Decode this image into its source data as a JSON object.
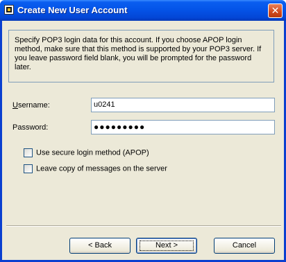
{
  "window": {
    "title": "Create New User Account",
    "close_label": "✕"
  },
  "info": {
    "text": "Specify POP3 login data for this account. If you choose APOP login method, make sure that this method is supported by your POP3 server. If you leave password field blank, you will be prompted for the password later."
  },
  "form": {
    "username_label": "Username:",
    "username_value": "u0241",
    "password_label": "Password:",
    "password_value": "●●●●●●●●●"
  },
  "options": {
    "apop_label": "Use secure login method (APOP)",
    "apop_checked": false,
    "leave_copy_label": "Leave copy of messages on the server",
    "leave_copy_checked": false
  },
  "buttons": {
    "back": "< Back",
    "next": "Next >",
    "cancel": "Cancel"
  },
  "colors": {
    "titlebar": "#0454e8",
    "client_bg": "#ece9d8",
    "border": "#7f9db9"
  }
}
